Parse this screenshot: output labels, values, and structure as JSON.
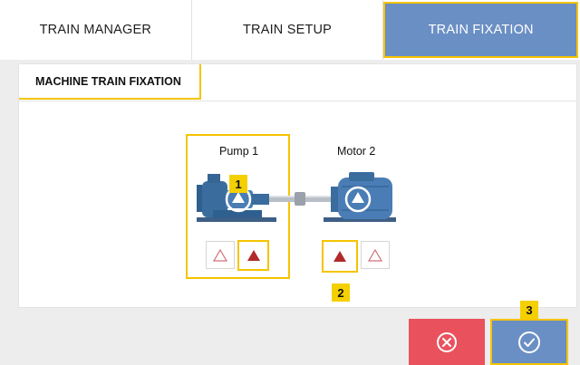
{
  "tabs": [
    {
      "label": "TRAIN MANAGER"
    },
    {
      "label": "TRAIN SETUP"
    },
    {
      "label": "TRAIN FIXATION"
    }
  ],
  "section": {
    "title": "MACHINE TRAIN FIXATION"
  },
  "machines": [
    {
      "label": "Pump 1",
      "color": "#3a6d9e"
    },
    {
      "label": "Motor 2",
      "color": "#4a7db5"
    }
  ],
  "badges": {
    "one": "1",
    "two": "2",
    "three": "3"
  },
  "colors": {
    "accent": "#6a8fc4",
    "highlight": "#f5c400",
    "cancel": "#e9525d",
    "fixed_marker": "#b22a2a"
  },
  "fixation_buttons": [
    {
      "machine": "Pump 1",
      "state": "unfixed",
      "icon": "triangle-outline-icon"
    },
    {
      "machine": "Pump 1",
      "state": "fixed",
      "icon": "triangle-filled-icon"
    },
    {
      "machine": "Motor 2",
      "state": "fixed",
      "icon": "triangle-filled-icon"
    },
    {
      "machine": "Motor 2",
      "state": "unfixed",
      "icon": "triangle-outline-icon"
    }
  ],
  "footer": {
    "cancel_icon": "cancel-circle-x-icon",
    "confirm_icon": "confirm-circle-check-icon"
  }
}
